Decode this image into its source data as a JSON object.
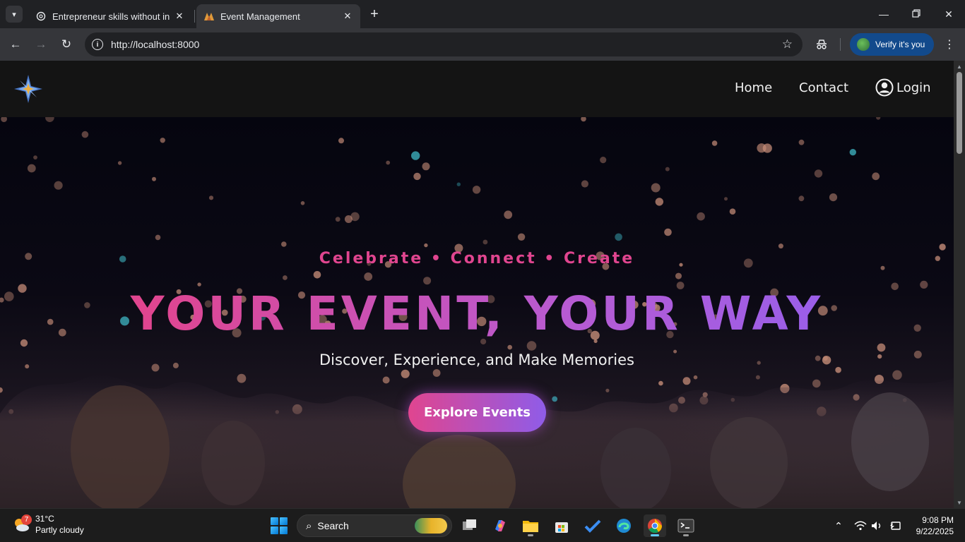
{
  "browser": {
    "tabs": [
      {
        "title": "Entrepreneur skills without inve",
        "active": false
      },
      {
        "title": "Event Management",
        "active": true
      }
    ],
    "address": "http://localhost:8000",
    "profile_label": "Verify it's you",
    "icons": {
      "tab_search": "chevron-down-icon",
      "back": "arrow-left-icon",
      "forward": "arrow-right-icon",
      "reload": "reload-icon",
      "bookmark": "star-icon",
      "extensions": "incognito-icon",
      "menu": "kebab-menu-icon"
    }
  },
  "site": {
    "nav": {
      "home": "Home",
      "contact": "Contact",
      "login": "Login"
    },
    "hero": {
      "tagline": "Celebrate • Connect • Create",
      "headline": "YOUR EVENT, YOUR WAY",
      "subheadline": "Discover, Experience, and Make Memories",
      "cta": "Explore Events"
    },
    "colors": {
      "accent_pink": "#e0458f",
      "accent_purple": "#8f5ce8",
      "nav_bg": "#141414"
    }
  },
  "taskbar": {
    "weather": {
      "temp": "31°C",
      "condition": "Partly cloudy",
      "badge": "7"
    },
    "search_label": "Search",
    "clock": {
      "time": "9:08 PM",
      "date": "9/22/2025"
    }
  }
}
